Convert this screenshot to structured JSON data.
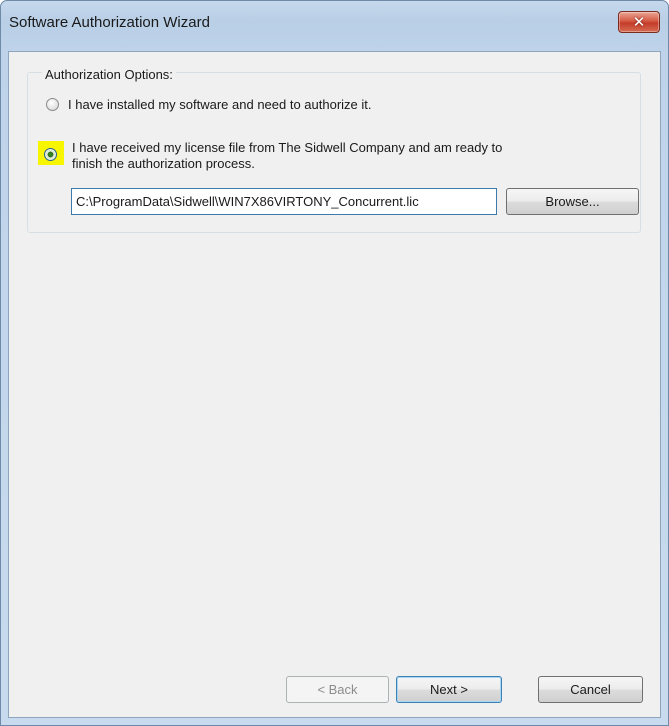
{
  "window": {
    "title": "Software Authorization Wizard",
    "close_glyph": "✕"
  },
  "group": {
    "label": "Authorization Options:"
  },
  "options": [
    {
      "text": "I have installed my software and need to authorize it.",
      "selected": false
    },
    {
      "text_line1": "I have received my license file from The Sidwell Company and am ready to",
      "text_line2": "finish the authorization process.",
      "selected": true
    }
  ],
  "license_path": {
    "value": "C:\\ProgramData\\Sidwell\\WIN7X86VIRTONY_Concurrent.lic"
  },
  "buttons": {
    "browse": "Browse...",
    "back": "< Back",
    "next": "Next >",
    "cancel": "Cancel"
  },
  "colors": {
    "highlight": "#f7f500",
    "close_button": "#c43c2a",
    "selected_radio": "#2a6e1b"
  }
}
